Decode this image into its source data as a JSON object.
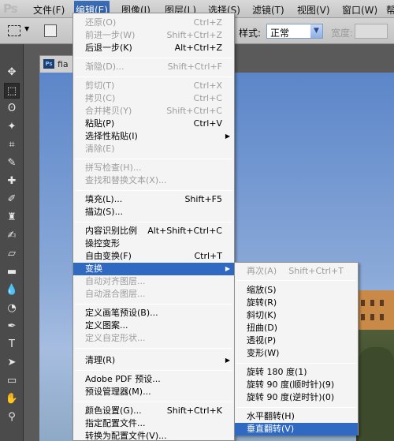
{
  "app": {
    "logo": "Ps"
  },
  "menubar": {
    "items": [
      "文件(F)",
      "编辑(E)",
      "图像(I)",
      "图层(L)",
      "选择(S)",
      "滤镜(T)",
      "视图(V)",
      "窗口(W)",
      "帮"
    ]
  },
  "options": {
    "style_label": "样式:",
    "style_value": "正常",
    "width_label": "宽度:"
  },
  "document": {
    "icon": "Ps",
    "name": "fia"
  },
  "edit_menu": {
    "items": [
      {
        "label": "还原(O)",
        "shortcut": "Ctrl+Z",
        "disabled": true
      },
      {
        "label": "前进一步(W)",
        "shortcut": "Shift+Ctrl+Z",
        "disabled": true
      },
      {
        "label": "后退一步(K)",
        "shortcut": "Alt+Ctrl+Z",
        "disabled": false
      },
      {
        "label": "渐隐(D)...",
        "shortcut": "Shift+Ctrl+F",
        "disabled": true
      },
      {
        "label": "剪切(T)",
        "shortcut": "Ctrl+X",
        "disabled": true
      },
      {
        "label": "拷贝(C)",
        "shortcut": "Ctrl+C",
        "disabled": true
      },
      {
        "label": "合并拷贝(Y)",
        "shortcut": "Shift+Ctrl+C",
        "disabled": true
      },
      {
        "label": "粘贴(P)",
        "shortcut": "Ctrl+V",
        "disabled": false
      },
      {
        "label": "选择性粘贴(I)",
        "shortcut": "",
        "disabled": false,
        "submenu": true
      },
      {
        "label": "清除(E)",
        "shortcut": "",
        "disabled": true
      },
      {
        "label": "拼写检查(H)...",
        "shortcut": "",
        "disabled": true
      },
      {
        "label": "查找和替换文本(X)...",
        "shortcut": "",
        "disabled": true
      },
      {
        "label": "填充(L)...",
        "shortcut": "Shift+F5",
        "disabled": false
      },
      {
        "label": "描边(S)...",
        "shortcut": "",
        "disabled": false
      },
      {
        "label": "内容识别比例",
        "shortcut": "Alt+Shift+Ctrl+C",
        "disabled": false
      },
      {
        "label": "操控变形",
        "shortcut": "",
        "disabled": false
      },
      {
        "label": "自由变换(F)",
        "shortcut": "Ctrl+T",
        "disabled": false
      },
      {
        "label": "变换",
        "shortcut": "",
        "disabled": false,
        "submenu": true,
        "highlighted": true
      },
      {
        "label": "自动对齐图层...",
        "shortcut": "",
        "disabled": true
      },
      {
        "label": "自动混合图层...",
        "shortcut": "",
        "disabled": true
      },
      {
        "label": "定义画笔预设(B)...",
        "shortcut": "",
        "disabled": false
      },
      {
        "label": "定义图案...",
        "shortcut": "",
        "disabled": false
      },
      {
        "label": "定义自定形状...",
        "shortcut": "",
        "disabled": true
      },
      {
        "label": "清理(R)",
        "shortcut": "",
        "disabled": false,
        "submenu": true
      },
      {
        "label": "Adobe PDF 预设...",
        "shortcut": "",
        "disabled": false
      },
      {
        "label": "预设管理器(M)...",
        "shortcut": "",
        "disabled": false
      },
      {
        "label": "颜色设置(G)...",
        "shortcut": "Shift+Ctrl+K",
        "disabled": false
      },
      {
        "label": "指定配置文件...",
        "shortcut": "",
        "disabled": false
      },
      {
        "label": "转换为配置文件(V)...",
        "shortcut": "",
        "disabled": false
      }
    ]
  },
  "transform_submenu": {
    "items": [
      {
        "label": "再次(A)",
        "shortcut": "Shift+Ctrl+T",
        "disabled": true
      },
      {
        "label": "缩放(S)",
        "shortcut": "",
        "disabled": false
      },
      {
        "label": "旋转(R)",
        "shortcut": "",
        "disabled": false
      },
      {
        "label": "斜切(K)",
        "shortcut": "",
        "disabled": false
      },
      {
        "label": "扭曲(D)",
        "shortcut": "",
        "disabled": false
      },
      {
        "label": "透视(P)",
        "shortcut": "",
        "disabled": false
      },
      {
        "label": "变形(W)",
        "shortcut": "",
        "disabled": false
      },
      {
        "label": "旋转 180 度(1)",
        "shortcut": "",
        "disabled": false
      },
      {
        "label": "旋转 90 度(顺时针)(9)",
        "shortcut": "",
        "disabled": false
      },
      {
        "label": "旋转 90 度(逆时针)(0)",
        "shortcut": "",
        "disabled": false
      },
      {
        "label": "水平翻转(H)",
        "shortcut": "",
        "disabled": false
      },
      {
        "label": "垂直翻转(V)",
        "shortcut": "",
        "disabled": false,
        "highlighted": true
      }
    ]
  },
  "toolbox": {
    "tools": [
      "move-tool-icon",
      "marquee-tool-icon",
      "lasso-tool-icon",
      "quick-select-tool-icon",
      "crop-tool-icon",
      "eyedropper-tool-icon",
      "healing-brush-tool-icon",
      "brush-tool-icon",
      "clone-stamp-tool-icon",
      "history-brush-tool-icon",
      "eraser-tool-icon",
      "gradient-tool-icon",
      "blur-tool-icon",
      "dodge-tool-icon",
      "pen-tool-icon",
      "type-tool-icon",
      "path-select-tool-icon",
      "shape-tool-icon",
      "hand-tool-icon",
      "zoom-tool-icon"
    ]
  }
}
